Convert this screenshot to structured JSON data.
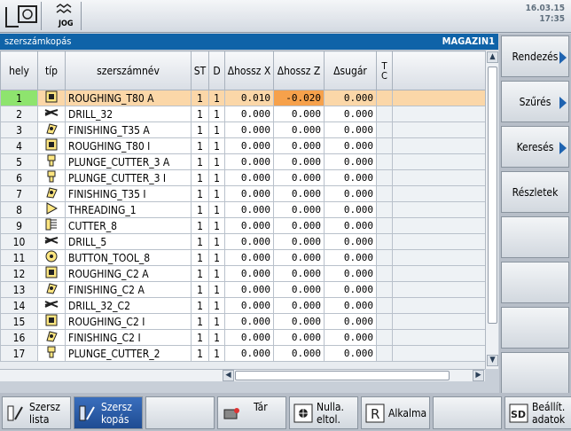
{
  "header": {
    "date": "16.03.15",
    "time": "17:35",
    "jog_label": "JOG"
  },
  "title": {
    "left": "szerszámkopás",
    "right": "MAGAZIN1"
  },
  "columns": [
    "hely",
    "típ",
    "szerszámnév",
    "ST",
    "D",
    "Δhossz X",
    "Δhossz Z",
    "Δsugár",
    "T C"
  ],
  "rows": [
    {
      "hely": "1",
      "name": "ROUGHING_T80 A",
      "st": "1",
      "d": "1",
      "x": "0.010",
      "z": "-0.020",
      "r": "0.000",
      "icon": "roughing-icon"
    },
    {
      "hely": "2",
      "name": "DRILL_32",
      "st": "1",
      "d": "1",
      "x": "0.000",
      "z": "0.000",
      "r": "0.000",
      "icon": "drill-icon"
    },
    {
      "hely": "3",
      "name": "FINISHING_T35 A",
      "st": "1",
      "d": "1",
      "x": "0.000",
      "z": "0.000",
      "r": "0.000",
      "icon": "finishing-icon"
    },
    {
      "hely": "4",
      "name": "ROUGHING_T80 I",
      "st": "1",
      "d": "1",
      "x": "0.000",
      "z": "0.000",
      "r": "0.000",
      "icon": "roughing-icon"
    },
    {
      "hely": "5",
      "name": "PLUNGE_CUTTER_3 A",
      "st": "1",
      "d": "1",
      "x": "0.000",
      "z": "0.000",
      "r": "0.000",
      "icon": "plunge-icon"
    },
    {
      "hely": "6",
      "name": "PLUNGE_CUTTER_3 I",
      "st": "1",
      "d": "1",
      "x": "0.000",
      "z": "0.000",
      "r": "0.000",
      "icon": "plunge-icon"
    },
    {
      "hely": "7",
      "name": "FINISHING_T35 I",
      "st": "1",
      "d": "1",
      "x": "0.000",
      "z": "0.000",
      "r": "0.000",
      "icon": "finishing-icon"
    },
    {
      "hely": "8",
      "name": "THREADING_1",
      "st": "1",
      "d": "1",
      "x": "0.000",
      "z": "0.000",
      "r": "0.000",
      "icon": "threading-icon"
    },
    {
      "hely": "9",
      "name": "CUTTER_8",
      "st": "1",
      "d": "1",
      "x": "0.000",
      "z": "0.000",
      "r": "0.000",
      "icon": "cutter-icon"
    },
    {
      "hely": "10",
      "name": "DRILL_5",
      "st": "1",
      "d": "1",
      "x": "0.000",
      "z": "0.000",
      "r": "0.000",
      "icon": "drill-icon"
    },
    {
      "hely": "11",
      "name": "BUTTON_TOOL_8",
      "st": "1",
      "d": "1",
      "x": "0.000",
      "z": "0.000",
      "r": "0.000",
      "icon": "button-tool-icon"
    },
    {
      "hely": "12",
      "name": "ROUGHING_C2 A",
      "st": "1",
      "d": "1",
      "x": "0.000",
      "z": "0.000",
      "r": "0.000",
      "icon": "roughing-icon"
    },
    {
      "hely": "13",
      "name": "FINISHING_C2 A",
      "st": "1",
      "d": "1",
      "x": "0.000",
      "z": "0.000",
      "r": "0.000",
      "icon": "finishing-icon"
    },
    {
      "hely": "14",
      "name": "DRILL_32_C2",
      "st": "1",
      "d": "1",
      "x": "0.000",
      "z": "0.000",
      "r": "0.000",
      "icon": "drill-icon"
    },
    {
      "hely": "15",
      "name": "ROUGHING_C2 I",
      "st": "1",
      "d": "1",
      "x": "0.000",
      "z": "0.000",
      "r": "0.000",
      "icon": "roughing-icon"
    },
    {
      "hely": "16",
      "name": "FINISHING_C2 I",
      "st": "1",
      "d": "1",
      "x": "0.000",
      "z": "0.000",
      "r": "0.000",
      "icon": "finishing-icon"
    },
    {
      "hely": "17",
      "name": "PLUNGE_CUTTER_2",
      "st": "1",
      "d": "1",
      "x": "0.000",
      "z": "0.000",
      "r": "0.000",
      "icon": "plunge-icon"
    }
  ],
  "right_buttons": [
    {
      "label": "Rendezés",
      "arrow": true
    },
    {
      "label": "Szűrés",
      "arrow": true
    },
    {
      "label": "Keresés",
      "arrow": true
    },
    {
      "label": "Részletek",
      "arrow": false
    },
    {
      "label": ""
    },
    {
      "label": ""
    },
    {
      "label": ""
    },
    {
      "label": ""
    }
  ],
  "bottom_buttons": [
    {
      "label1": "Szersz",
      "label2": "lista",
      "active": false,
      "icon": "tool-list-icon"
    },
    {
      "label1": "Szersz",
      "label2": "kopás",
      "active": true,
      "icon": "tool-wear-icon"
    },
    {
      "label1": "",
      "label2": "",
      "active": false,
      "icon": ""
    },
    {
      "label1": "Tár",
      "label2": "",
      "active": false,
      "icon": "magazine-icon"
    },
    {
      "label1": "Nulla.",
      "label2": "eltol.",
      "active": false,
      "icon": "zero-offset-icon"
    },
    {
      "label1": "Alkalma",
      "label2": "",
      "active": false,
      "icon": "r-parameter-icon"
    },
    {
      "label1": "",
      "label2": "",
      "active": false,
      "icon": ""
    },
    {
      "label1": "Beállít.",
      "label2": "adatok",
      "active": false,
      "icon": "setting-data-icon"
    }
  ],
  "colors": {
    "title_bg": "#0f63a8",
    "selected_row": "#fbd7a8",
    "selected_index": "#8ee46e",
    "highlight_cell": "#f6a14b"
  }
}
